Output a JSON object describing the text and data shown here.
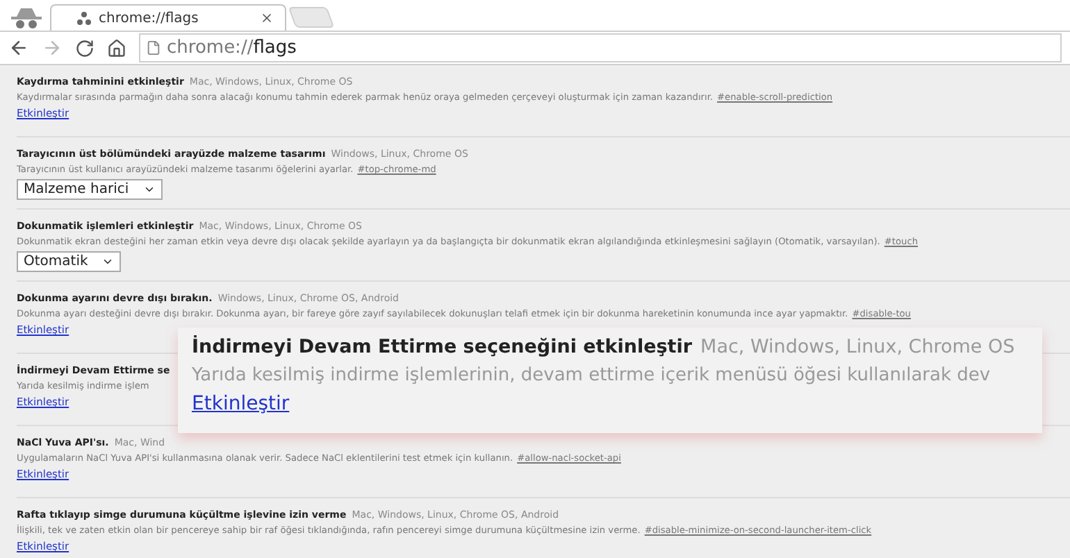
{
  "tabs": [
    {
      "title": "chrome://flags",
      "selected": true
    }
  ],
  "address": {
    "prefix": "chrome://",
    "host": "flags"
  },
  "flags": [
    {
      "kind": "link",
      "title": "Kaydırma tahminini etkinleştir",
      "platforms": "Mac, Windows, Linux, Chrome OS",
      "description": "Kaydırmalar sırasında parmağın daha sonra alacağı konumu tahmin ederek parmak henüz oraya gelmeden çerçeveyi oluşturmak için zaman kazandırır.",
      "anchor": "#enable-scroll-prediction",
      "action": "Etkinleştir"
    },
    {
      "kind": "select",
      "title": "Tarayıcının üst bölümündeki arayüzde malzeme tasarımı",
      "platforms": "Windows, Linux, Chrome OS",
      "description": "Tarayıcının üst kullanıcı arayüzündeki malzeme tasarımı öğelerini ayarlar.",
      "anchor": "#top-chrome-md",
      "value": "Malzeme harici"
    },
    {
      "kind": "select",
      "title": "Dokunmatik işlemleri etkinleştir",
      "platforms": "Mac, Windows, Linux, Chrome OS",
      "description": "Dokunmatik ekran desteğini her zaman etkin veya devre dışı olacak şekilde ayarlayın ya da başlangıçta bir dokunmatik ekran algılandığında etkinleşmesini sağlayın (Otomatik, varsayılan).",
      "anchor": "#touch",
      "value": "Otomatik"
    },
    {
      "kind": "link",
      "title": "Dokunma ayarını devre dışı bırakın.",
      "platforms": "Windows, Linux, Chrome OS, Android",
      "description": "Dokunma ayarı desteğini devre dışı bırakır. Dokunma ayarı, bir fareye göre zayıf sayılabilecek dokunuşları telafi etmek için bir dokunma hareketinin konumunda ince ayar yapmaktır.",
      "anchor": "#disable-tou",
      "action": "Etkinleştir"
    },
    {
      "kind": "link",
      "title": "İndirmeyi Devam Ettirme se",
      "description": "Yarıda kesilmiş indirme işlem",
      "action": "Etkinleştir"
    },
    {
      "kind": "link",
      "title": "NaCl Yuva API'sı.",
      "platforms": "Mac, Wind",
      "description": "Uygulamaların NaCl Yuva API'si kullanmasına olanak verir. Sadece NaCl eklentilerini test etmek için kullanın.",
      "anchor": "#allow-nacl-socket-api",
      "action": "Etkinleştir"
    },
    {
      "kind": "link",
      "title": "Rafta tıklayıp simge durumuna küçültme işlevine izin verme",
      "platforms": "Mac, Windows, Linux, Chrome OS, Android",
      "description": "İlişkili, tek ve zaten etkin olan bir pencereye sahip bir raf öğesi tıklandığında, rafın pencereyi simge durumuna küçültmesine izin verme.",
      "anchor": "#disable-minimize-on-second-launcher-item-click",
      "action": "Etkinleştir"
    }
  ],
  "callout": {
    "title": "İndirmeyi Devam Ettirme seçeneğini etkinleştir",
    "platforms": "Mac, Windows, Linux, Chrome OS",
    "description": "Yarıda kesilmiş indirme işlemlerinin, devam ettirme içerik menüsü öğesi kullanılarak dev",
    "action": "Etkinleştir"
  }
}
